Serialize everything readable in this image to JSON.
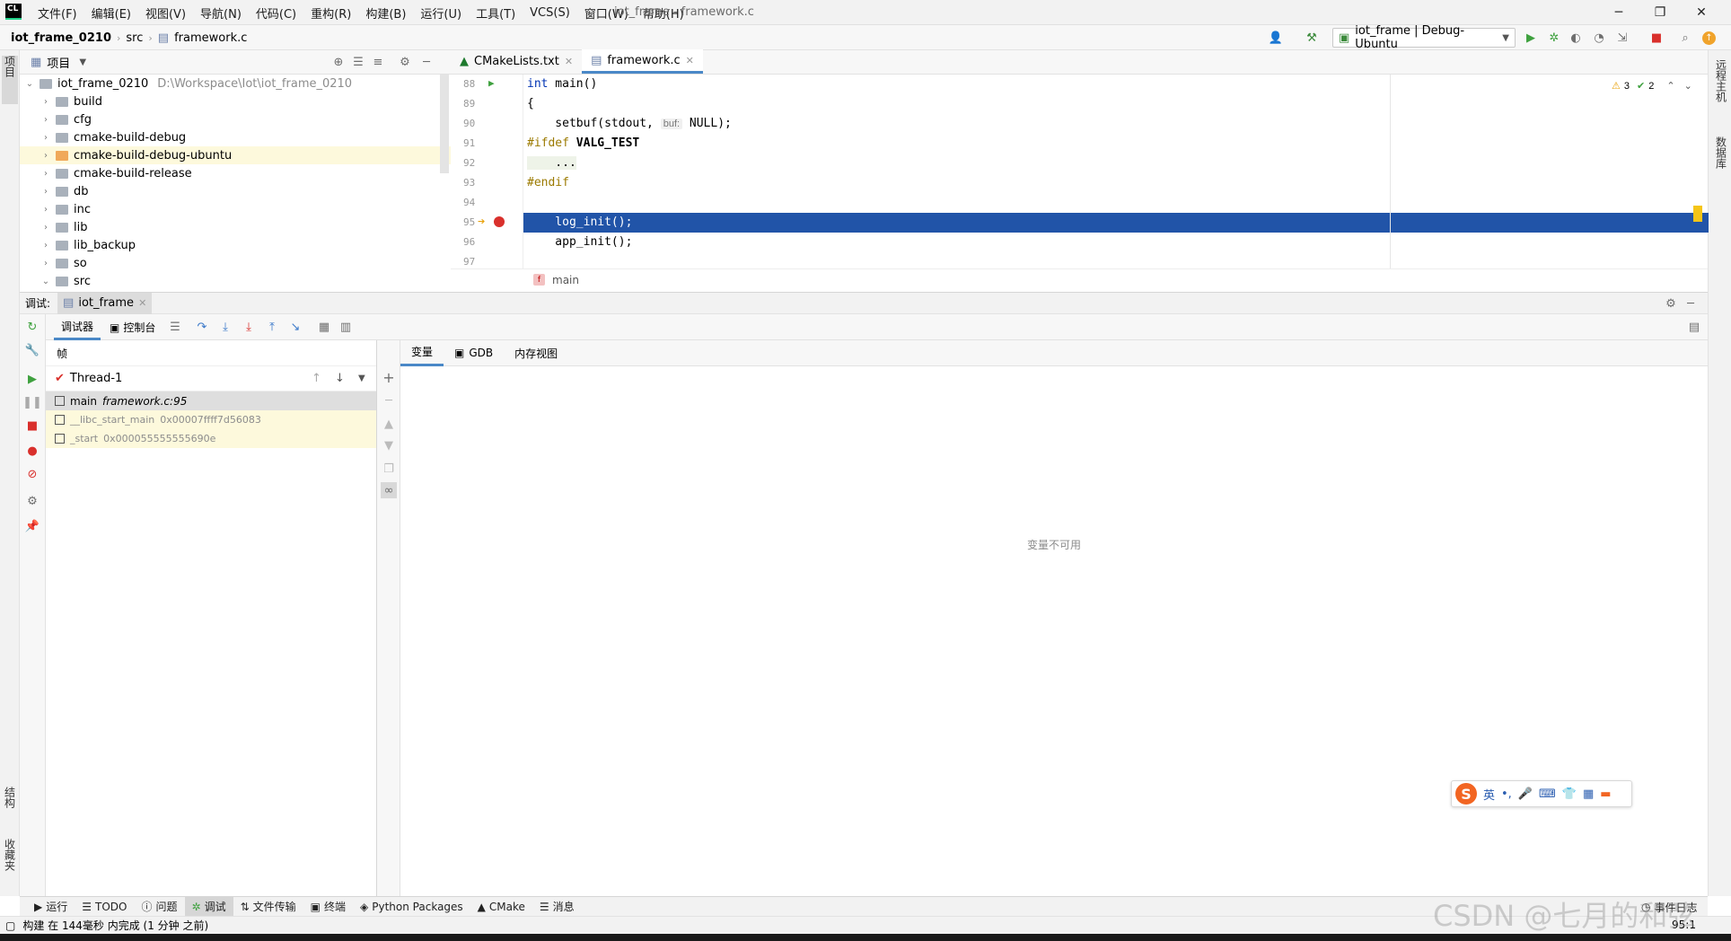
{
  "titlebar": {
    "menu": [
      "文件(F)",
      "编辑(E)",
      "视图(V)",
      "导航(N)",
      "代码(C)",
      "重构(R)",
      "构建(B)",
      "运行(U)",
      "工具(T)",
      "VCS(S)",
      "窗口(W)",
      "帮助(H)"
    ],
    "window_title": "iot_frame - framework.c",
    "app_logo": "CL"
  },
  "navbar": {
    "crumbs": [
      "iot_frame_0210",
      "src",
      "framework.c"
    ],
    "run_config": "iot_frame | Debug-Ubuntu"
  },
  "left_strip": {
    "project_tab": "项目",
    "structure_tab": "结构",
    "bookmarks_tab": "收藏夹"
  },
  "right_strip": {
    "remote_tab": "远程主机",
    "db_tab": "数据库"
  },
  "project": {
    "title": "项目",
    "root": {
      "name": "iot_frame_0210",
      "path": "D:\\Workspace\\Iot\\iot_frame_0210"
    },
    "items": [
      "build",
      "cfg",
      "cmake-build-debug",
      "cmake-build-debug-ubuntu",
      "cmake-build-release",
      "db",
      "inc",
      "lib",
      "lib_backup",
      "so",
      "src"
    ]
  },
  "editor": {
    "tabs": [
      "CMakeLists.txt",
      "framework.c"
    ],
    "warnings": "3",
    "oks": "2",
    "line_numbers": [
      "88",
      "89",
      "90",
      "91",
      "92",
      "93",
      "94",
      "95",
      "96",
      "97"
    ],
    "lines": {
      "l88_kw": "int",
      "l88_rest": " main()",
      "l89": "{",
      "l90_a": "    setbuf(stdout, ",
      "l90_hint": "buf:",
      "l90_b": " NULL);",
      "l91_pp": "#ifdef",
      "l91_rest": " VALG_TEST",
      "l92": "    ...",
      "l93_pp": "#endif",
      "l94": "",
      "l95": "    log_init();",
      "l96": "    app_init();"
    },
    "breadcrumb_fn": "main",
    "breadcrumb_badge": "f"
  },
  "debug": {
    "label": "调试:",
    "session_tab": "iot_frame",
    "debugger_tab": "调试器",
    "console_tab": "控制台",
    "frames_header": "帧",
    "thread": "Thread-1",
    "frames": [
      {
        "fn": "main",
        "loc": "framework.c:95"
      },
      {
        "fn": "__libc_start_main",
        "loc": "0x00007ffff7d56083"
      },
      {
        "fn": "_start",
        "loc": "0x000055555555690e"
      }
    ],
    "var_tabs": [
      "变量",
      "GDB",
      "内存视图"
    ],
    "no_vars": "变量不可用"
  },
  "ime": {
    "lang": "英",
    "punct": "•,"
  },
  "toolwindows": [
    "运行",
    "TODO",
    "问题",
    "调试",
    "文件传输",
    "终端",
    "Python Packages",
    "CMake",
    "消息"
  ],
  "status": {
    "text": "构建 在 144毫秒 内完成 (1 分钟 之前)",
    "event_log": "事件日志",
    "position": "95:1"
  },
  "watermark": "CSDN @七月的和弦"
}
